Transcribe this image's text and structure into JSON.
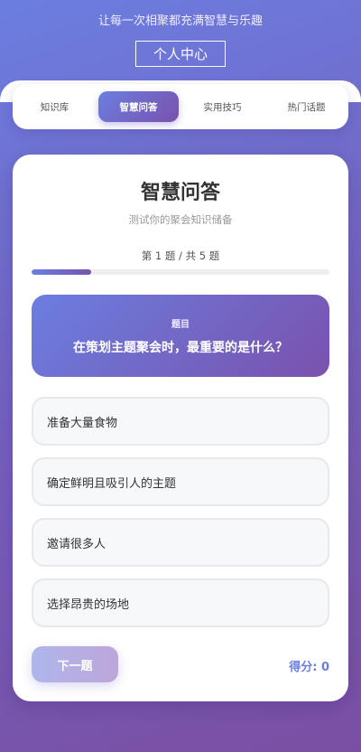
{
  "header": {
    "slogan": "让每一次相聚都充满智慧与乐趣",
    "profile_button": "个人中心"
  },
  "tabs": [
    {
      "label": "知识库",
      "active": false
    },
    {
      "label": "智慧问答",
      "active": true
    },
    {
      "label": "实用技巧",
      "active": false
    },
    {
      "label": "热门话题",
      "active": false
    }
  ],
  "quiz": {
    "title": "智慧问答",
    "subtitle": "测试你的聚会知识储备",
    "progress_text": "第 1 题 / 共 5 题",
    "progress": {
      "current": 1,
      "total": 5
    },
    "question_label": "题目",
    "question": "在策划主题聚会时，最重要的是什么？",
    "options": [
      "准备大量食物",
      "确定鲜明且吸引人的主题",
      "邀请很多人",
      "选择昂贵的场地"
    ],
    "next_label": "下一题",
    "score_label": "得分: 0"
  },
  "colors": {
    "accent_start": "#6b7ee0",
    "accent_end": "#7a52ad",
    "score_color": "#6b7ee0"
  }
}
